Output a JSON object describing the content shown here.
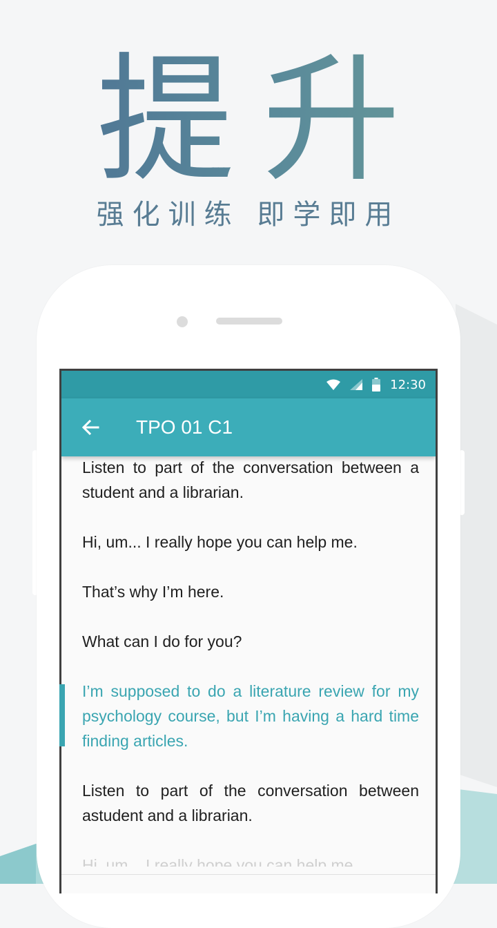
{
  "promo": {
    "headline": "提升",
    "subline": "强化训练 即学即用"
  },
  "status_bar": {
    "time": "12:30",
    "icons": [
      "wifi-icon",
      "cell-signal-icon",
      "battery-icon"
    ]
  },
  "app_bar": {
    "back_icon": "arrow-back-icon",
    "title": "TPO 01 C1"
  },
  "transcript": [
    {
      "text": "Listen to part of the conversation between a student and a librarian.",
      "active": false
    },
    {
      "text": "Hi, um... I really hope you can help me.",
      "active": false
    },
    {
      "text": "That’s why I’m here.",
      "active": false
    },
    {
      "text": "What can I do for you?",
      "active": false
    },
    {
      "text": "I’m supposed to do a literature review for my psychology course, but I’m having a hard time finding articles.",
      "active": true
    },
    {
      "text": "Listen to part of the conversation between astudent and a librarian.",
      "active": false
    }
  ],
  "colors": {
    "status_bar": "#2f9ba6",
    "app_bar": "#3cadb9",
    "highlight": "#3aa5b1",
    "headline": "#4f7a96"
  }
}
